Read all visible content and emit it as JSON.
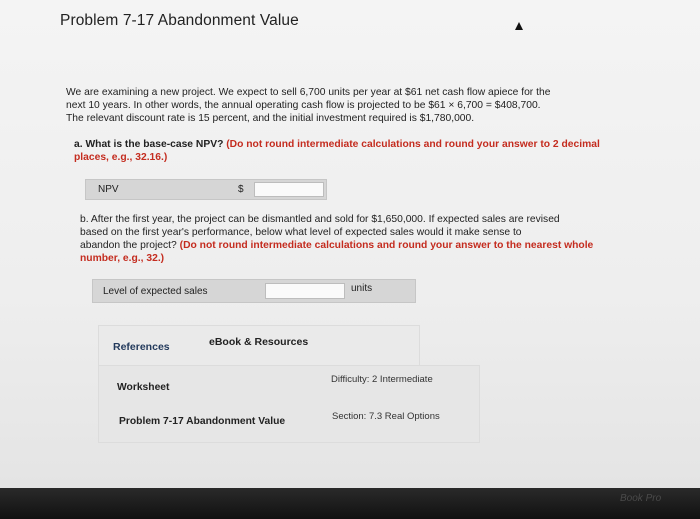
{
  "header": {
    "title": "Problem 7-17 Abandonment Value"
  },
  "intro": {
    "line1": "We are examining a new project. We expect to sell 6,700 units per year at $61 net cash flow apiece for the",
    "line2": "next 10 years. In other words, the annual operating cash flow is projected to be $61 × 6,700 = $408,700.",
    "line3": "The relevant discount rate is 15 percent, and the initial investment required is $1,780,000."
  },
  "part_a": {
    "question": "a. What is the base-case NPV?",
    "instruction": "(Do not round intermediate calculations and round your answer to 2 decimal places, e.g., 32.16.)",
    "label": "NPV",
    "currency": "$",
    "value": ""
  },
  "part_b": {
    "question_line1": "b. After the first year, the project can be dismantled and sold for $1,650,000. If expected sales are revised",
    "question_line2": "based on the first year's performance, below what level of expected sales would it make sense to",
    "question_line3": "abandon the project?",
    "instruction": "(Do not round intermediate calculations and round your answer to the nearest whole number, e.g., 32.)",
    "label": "Level of expected sales",
    "value": "",
    "unit": "units"
  },
  "tabs": {
    "references": "References",
    "ebook": "eBook & Resources"
  },
  "info": {
    "worksheet": "Worksheet",
    "difficulty": "Difficulty: 2 Intermediate",
    "problem_title": "Problem 7-17 Abandonment Value",
    "section": "Section: 7.3 Real Options"
  },
  "watermark": "Book Pro"
}
